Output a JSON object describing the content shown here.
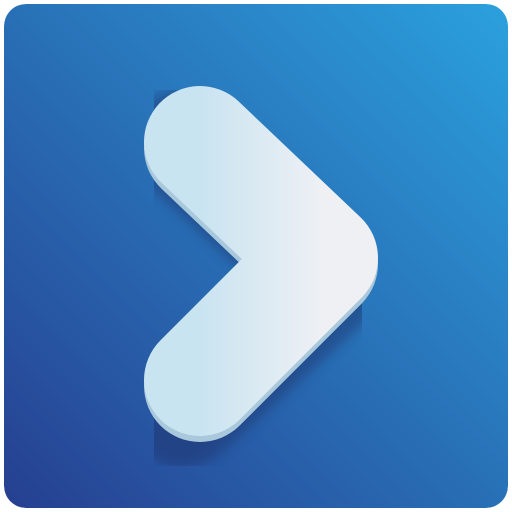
{
  "icon": {
    "name": "chevron-right-app-icon",
    "glyph": "chevron-right-icon",
    "colors": {
      "background_gradient_bottom_left": "#263f90",
      "background_gradient_top_right": "#2ba1dd",
      "chevron_fill_left": "#c9e4f1",
      "chevron_fill_right": "#eef0f4",
      "chevron_shadow": "#1c2f66"
    }
  }
}
